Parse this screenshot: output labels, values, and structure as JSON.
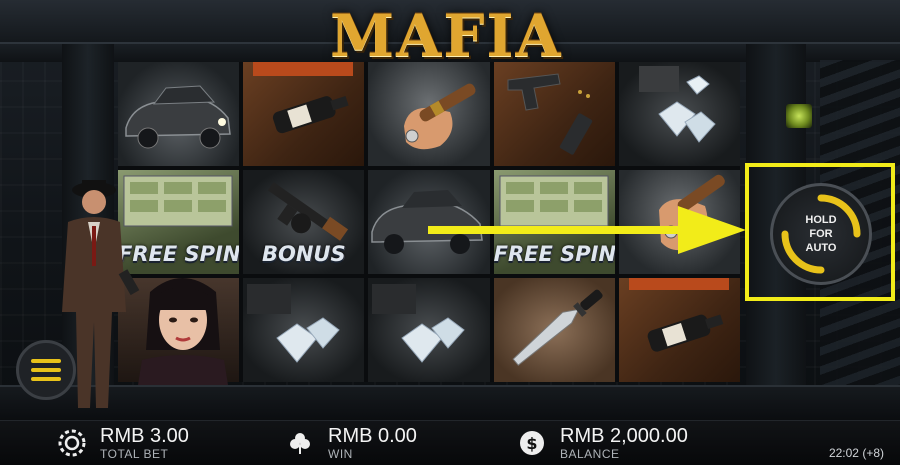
{
  "game": {
    "title": "MAFIA"
  },
  "reels": {
    "columns": [
      [
        "car",
        "money",
        "lady"
      ],
      [
        "bottle",
        "gun",
        "diamonds"
      ],
      [
        "cigar",
        "car",
        "diamonds"
      ],
      [
        "pistol",
        "money",
        "knife"
      ],
      [
        "diamonds",
        "cigar",
        "bottle"
      ]
    ],
    "labels": {
      "free_spins": "FREE SPINS",
      "bonus": "BONUS"
    }
  },
  "controls": {
    "hold_for_auto": "HOLD\nFOR\nAUTO",
    "highlight_color": "#f2ec19",
    "accent_color": "#e8c21a"
  },
  "bottom_bar": {
    "total_bet": {
      "value": "RMB 3.00",
      "label": "TOTAL BET",
      "icon": "chip-icon"
    },
    "win": {
      "value": "RMB 0.00",
      "label": "WIN",
      "icon": "clover-icon"
    },
    "balance": {
      "value": "RMB 2,000.00",
      "label": "BALANCE",
      "icon": "dollar-coin-icon"
    },
    "clock": "22:02 (+8)"
  }
}
